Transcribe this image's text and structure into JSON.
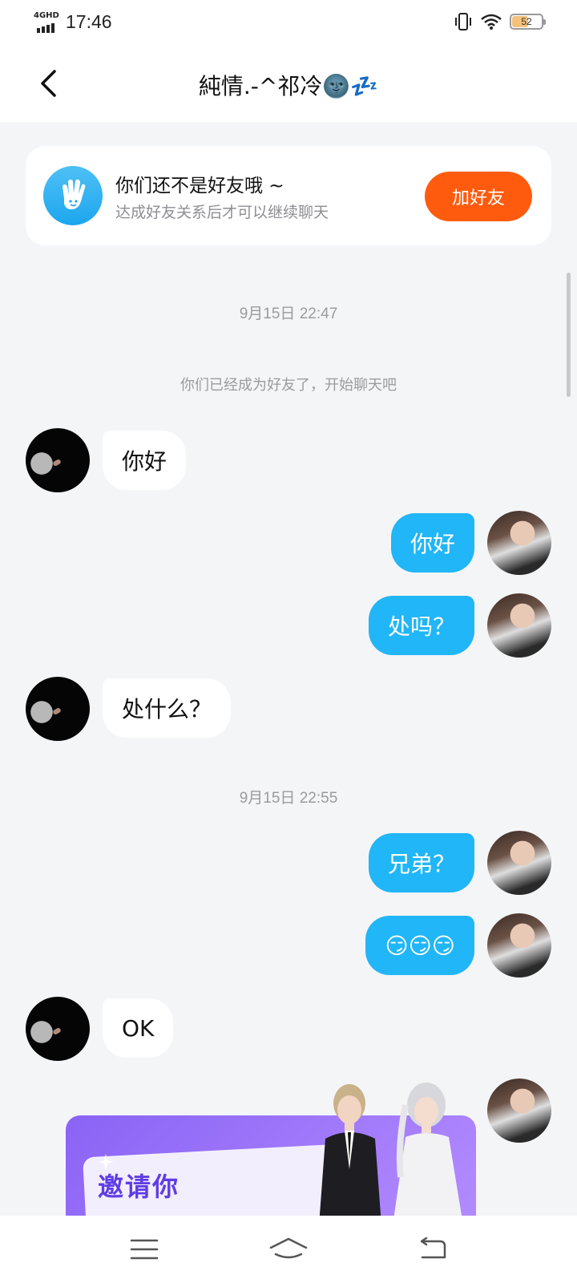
{
  "status_bar": {
    "network": "4GHD",
    "time": "17:46",
    "battery": "52",
    "battery_level": 0.52
  },
  "header": {
    "title": "純情.-^祁冷🌚💤"
  },
  "friend_notice": {
    "title": "你们还不是好友哦 ~",
    "subtitle": "达成好友关系后才可以继续聊天",
    "button": "加好友"
  },
  "chat": {
    "timestamp_1": "9月15日 22:47",
    "system_message": "你们已经成为好友了，开始聊天吧",
    "messages": [
      {
        "side": "in",
        "text": "你好"
      },
      {
        "side": "out",
        "text": "你好"
      },
      {
        "side": "out",
        "text": "处吗？"
      },
      {
        "side": "in",
        "text": "处什么？"
      },
      {
        "side": "out",
        "text": "兄弟？"
      },
      {
        "side": "out",
        "text": "😏😏😏"
      },
      {
        "side": "in",
        "text": "OK"
      }
    ],
    "timestamp_2": "9月15日 22:55",
    "invite_card": {
      "title": "邀请你"
    }
  },
  "colors": {
    "accent_blue": "#21b6f7",
    "add_friend_orange": "#ff5b0e",
    "background": "#f4f5f7"
  },
  "icons": {
    "back": "chevron-left-icon",
    "notice": "waving-hand-icon",
    "nav_menu": "menu-icon",
    "nav_home": "home-icon",
    "nav_back": "return-icon"
  }
}
